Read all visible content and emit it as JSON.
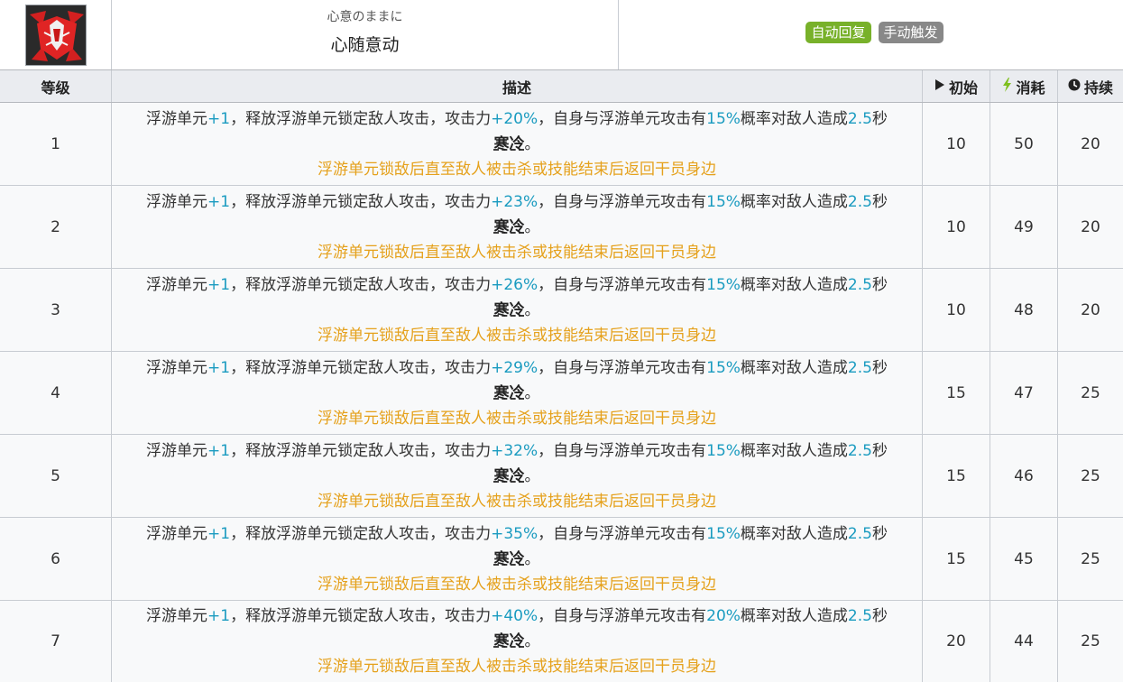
{
  "skill": {
    "subtitle": "心意のままに",
    "name": "心随意动",
    "tags": [
      "自动回复",
      "手动触发"
    ],
    "icon": "skill-icon"
  },
  "table": {
    "headers": {
      "level": "等级",
      "description": "描述",
      "initial": "初始",
      "cost": "消耗",
      "duration": "持续"
    },
    "header_icons": [
      "play-icon",
      "bolt-icon",
      "clock-icon"
    ],
    "rows": [
      {
        "level": "1",
        "desc_a": "浮游单元",
        "p1": "+1",
        "desc_b": "，释放浮游单元锁定敌人攻击，攻击力",
        "atk": "+20%",
        "desc_c": "，自身与浮游单元攻击有",
        "chance": "15%",
        "desc_d": "概率对敌人造成",
        "sec": "2.5",
        "desc_e": "秒",
        "status": "寒冷",
        "period": "。",
        "note": "浮游单元锁敌后直至敌人被击杀或技能结束后返回干员身边",
        "initial": "10",
        "cost": "50",
        "duration": "20"
      },
      {
        "level": "2",
        "desc_a": "浮游单元",
        "p1": "+1",
        "desc_b": "，释放浮游单元锁定敌人攻击，攻击力",
        "atk": "+23%",
        "desc_c": "，自身与浮游单元攻击有",
        "chance": "15%",
        "desc_d": "概率对敌人造成",
        "sec": "2.5",
        "desc_e": "秒",
        "status": "寒冷",
        "period": "。",
        "note": "浮游单元锁敌后直至敌人被击杀或技能结束后返回干员身边",
        "initial": "10",
        "cost": "49",
        "duration": "20"
      },
      {
        "level": "3",
        "desc_a": "浮游单元",
        "p1": "+1",
        "desc_b": "，释放浮游单元锁定敌人攻击，攻击力",
        "atk": "+26%",
        "desc_c": "，自身与浮游单元攻击有",
        "chance": "15%",
        "desc_d": "概率对敌人造成",
        "sec": "2.5",
        "desc_e": "秒",
        "status": "寒冷",
        "period": "。",
        "note": "浮游单元锁敌后直至敌人被击杀或技能结束后返回干员身边",
        "initial": "10",
        "cost": "48",
        "duration": "20"
      },
      {
        "level": "4",
        "desc_a": "浮游单元",
        "p1": "+1",
        "desc_b": "，释放浮游单元锁定敌人攻击，攻击力",
        "atk": "+29%",
        "desc_c": "，自身与浮游单元攻击有",
        "chance": "15%",
        "desc_d": "概率对敌人造成",
        "sec": "2.5",
        "desc_e": "秒",
        "status": "寒冷",
        "period": "。",
        "note": "浮游单元锁敌后直至敌人被击杀或技能结束后返回干员身边",
        "initial": "15",
        "cost": "47",
        "duration": "25"
      },
      {
        "level": "5",
        "desc_a": "浮游单元",
        "p1": "+1",
        "desc_b": "，释放浮游单元锁定敌人攻击，攻击力",
        "atk": "+32%",
        "desc_c": "，自身与浮游单元攻击有",
        "chance": "15%",
        "desc_d": "概率对敌人造成",
        "sec": "2.5",
        "desc_e": "秒",
        "status": "寒冷",
        "period": "。",
        "note": "浮游单元锁敌后直至敌人被击杀或技能结束后返回干员身边",
        "initial": "15",
        "cost": "46",
        "duration": "25"
      },
      {
        "level": "6",
        "desc_a": "浮游单元",
        "p1": "+1",
        "desc_b": "，释放浮游单元锁定敌人攻击，攻击力",
        "atk": "+35%",
        "desc_c": "，自身与浮游单元攻击有",
        "chance": "15%",
        "desc_d": "概率对敌人造成",
        "sec": "2.5",
        "desc_e": "秒",
        "status": "寒冷",
        "period": "。",
        "note": "浮游单元锁敌后直至敌人被击杀或技能结束后返回干员身边",
        "initial": "15",
        "cost": "45",
        "duration": "25"
      },
      {
        "level": "7",
        "desc_a": "浮游单元",
        "p1": "+1",
        "desc_b": "，释放浮游单元锁定敌人攻击，攻击力",
        "atk": "+40%",
        "desc_c": "，自身与浮游单元攻击有",
        "chance": "20%",
        "desc_d": "概率对敌人造成",
        "sec": "2.5",
        "desc_e": "秒",
        "status": "寒冷",
        "period": "。",
        "note": "浮游单元锁敌后直至敌人被击杀或技能结束后返回干员身边",
        "initial": "20",
        "cost": "44",
        "duration": "25"
      }
    ]
  },
  "colors": {
    "tag_auto": "#78b12a",
    "tag_manual": "#888888",
    "value_blue": "#1a9bc0",
    "note_orange": "#e5a11c",
    "header_bg": "#eaecf0",
    "row_bg": "#f8f9fa"
  }
}
